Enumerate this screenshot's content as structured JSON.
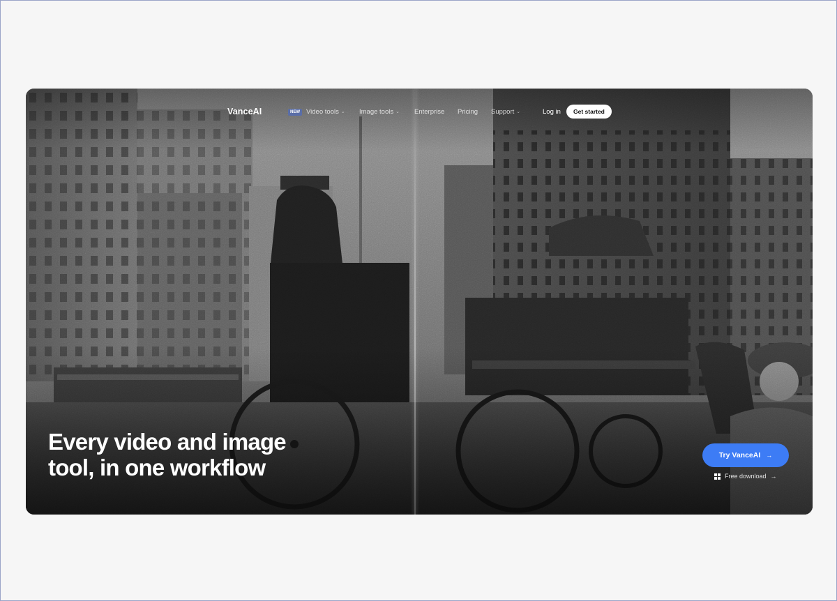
{
  "nav": {
    "logo": "VanceAI",
    "new_badge": "NEW",
    "video_tools": "Video tools",
    "image_tools": "Image tools",
    "enterprise": "Enterprise",
    "pricing": "Pricing",
    "support": "Support",
    "login": "Log in",
    "get_started": "Get started"
  },
  "hero": {
    "headline_line1": "Every video and image",
    "headline_line2": "tool, in one workflow",
    "cta_label": "Try VanceAI",
    "cta_arrow": "→",
    "free_download": "Free download",
    "free_download_arrow": "→"
  },
  "colors": {
    "accent": "#3d7cf5",
    "background": "#f6f6f6",
    "hero_dark": "#3a3a3a"
  },
  "icons": {
    "chevron": "chevron-down-icon",
    "windows": "windows-icon",
    "arrow": "arrow-right-icon"
  }
}
